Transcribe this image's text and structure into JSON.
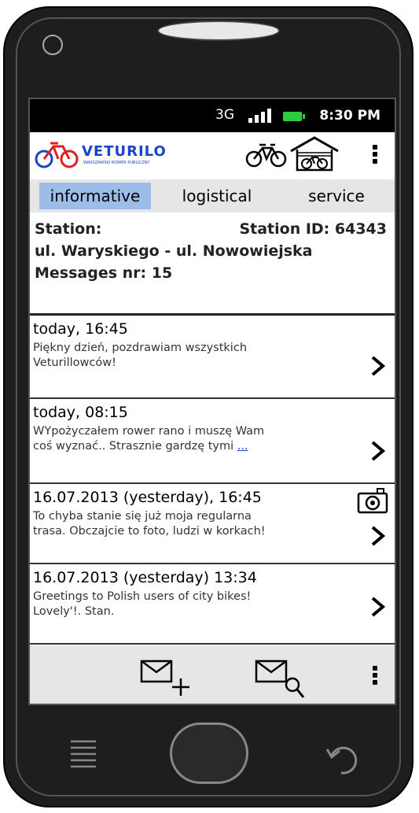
{
  "status_bar": {
    "network": "3G",
    "time": "8:30 PM"
  },
  "app_bar": {
    "logo_text": "VETURILO",
    "logo_subtext": "WARSZAWSKI ROWER PUBLICZNY",
    "icons": [
      "bike-icon",
      "garage-icon",
      "overflow-menu-icon"
    ]
  },
  "tabs": [
    {
      "label": "informative",
      "active": true
    },
    {
      "label": "logistical",
      "active": false
    },
    {
      "label": "service",
      "active": false
    }
  ],
  "station": {
    "label": "Station:",
    "id_text": "Station ID: 64343",
    "street": "ul. Waryskiego - ul. Nowowiejska",
    "messages_count": "Messages nr: 15"
  },
  "messages": [
    {
      "date": "today, 16:45",
      "line1": "Piękny dzień, pozdrawiam wszystkich",
      "line2": "Veturillowców!",
      "more": "",
      "has_photo": false
    },
    {
      "date": "today, 08:15",
      "line1": "WYpożyczałem rower rano i muszę Wam",
      "line2": "coś wyznać.. Strasznie gardzę tymi ",
      "more": "...",
      "has_photo": false
    },
    {
      "date": "16.07.2013 (yesterday), 16:45",
      "line1": "To chyba stanie się już moja regularna",
      "line2": "trasa. Obczajcie to foto, ludzi w korkach!",
      "more": "",
      "has_photo": true
    },
    {
      "date": "16.07.2013 (yesterday) 13:34",
      "line1": "Greetings to Polish users of city bikes!",
      "line2": "Lovely'!. Stan.",
      "more": "",
      "has_photo": false
    }
  ],
  "bottom_bar": {
    "icons": [
      "new-message-icon",
      "search-messages-icon",
      "overflow-menu-icon"
    ]
  },
  "colors": {
    "accent": "#1a44c8",
    "tab_active": "#9dbde8",
    "battery": "#2ecc40"
  }
}
